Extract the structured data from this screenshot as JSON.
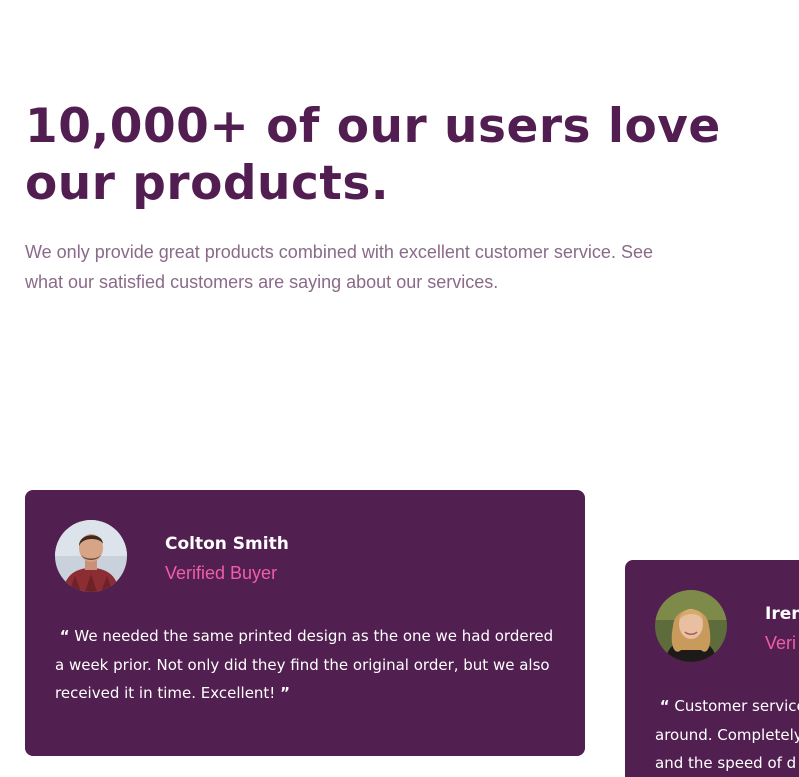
{
  "section": {
    "title": "10,000+ of our users love our products.",
    "intro": "We only provide great products combined with excellent customer service. See what our satisfied customers are saying about our services."
  },
  "colors": {
    "headline": "#521e51",
    "card_background": "#521f51",
    "role_accent": "#ef5ea7",
    "intro_text": "#8a6a89"
  },
  "testimonials": [
    {
      "name": "Colton Smith",
      "role": "Verified Buyer",
      "open_quote": "“",
      "quote": "We needed the same printed design as the one we had ordered a week prior. Not only did they find the original order, but we also received it in time. Excellent!",
      "close_quote": "”",
      "avatar": "man-portrait-avatar"
    },
    {
      "name": "Iren",
      "role": "Veri",
      "open_quote": "“",
      "quote_lines": [
        "Customer service",
        "around. Completely",
        "and the speed of d"
      ],
      "avatar": "woman-portrait-avatar"
    }
  ]
}
